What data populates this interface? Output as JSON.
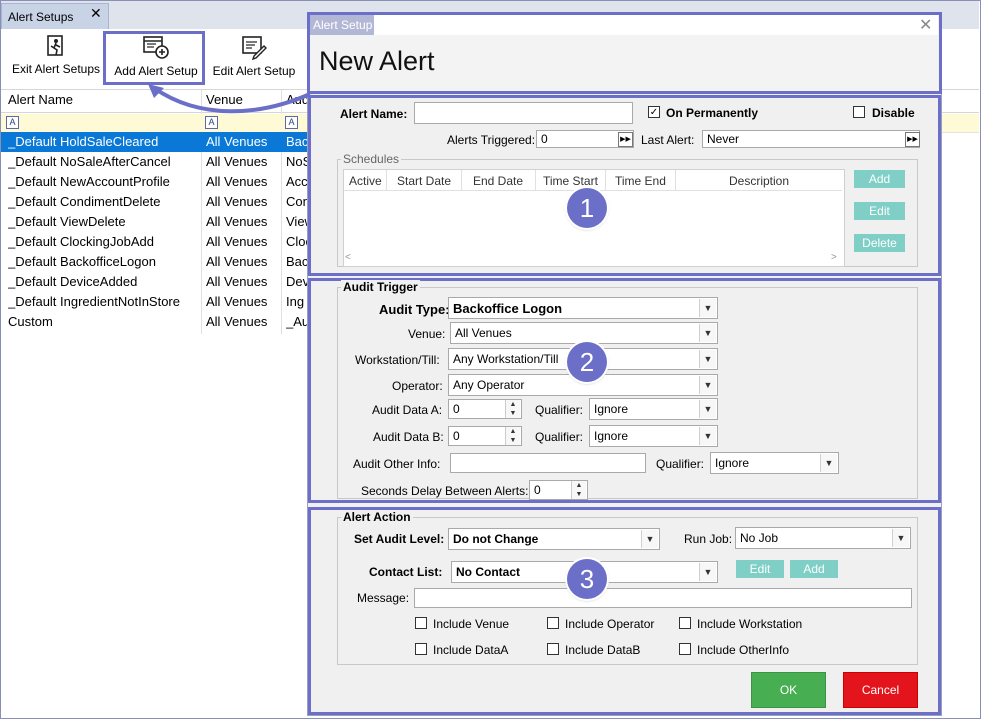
{
  "tab": {
    "title": "Alert Setups",
    "close": "✕"
  },
  "toolbar": {
    "exit_label": "Exit Alert Setups",
    "add_label": "Add Alert Setup",
    "edit_label": "Edit Alert Setup"
  },
  "grid": {
    "headers": [
      "Alert Name",
      "Venue",
      "Aud"
    ],
    "rows": [
      [
        "_Default HoldSaleCleared",
        "All Venues",
        "Bac"
      ],
      [
        "_Default NoSaleAfterCancel",
        "All Venues",
        "NoS"
      ],
      [
        "_Default NewAccountProfile",
        "All Venues",
        "Acc"
      ],
      [
        "_Default CondimentDelete",
        "All Venues",
        "Con"
      ],
      [
        "_Default ViewDelete",
        "All Venues",
        "View"
      ],
      [
        "_Default ClockingJobAdd",
        "All Venues",
        "Cloc"
      ],
      [
        "_Default BackofficeLogon",
        "All Venues",
        "Bac"
      ],
      [
        "_Default DeviceAdded",
        "All Venues",
        "Dev"
      ],
      [
        "_Default IngredientNotInStore",
        "All Venues",
        "Ing"
      ],
      [
        "Custom",
        "All Venues",
        "_Au"
      ]
    ],
    "selected_row": 0
  },
  "dialog": {
    "caption": "Alert Setup",
    "close": "✕",
    "title": "New Alert",
    "alert_name_label": "Alert Name:",
    "alert_name_value": "",
    "on_permanently_label": "On Permanently",
    "on_permanently_checked": true,
    "disable_label": "Disable",
    "disable_checked": false,
    "alerts_triggered_label": "Alerts Triggered:",
    "alerts_triggered_value": "0",
    "last_alert_label": "Last Alert:",
    "last_alert_value": "Never",
    "schedules": {
      "title": "Schedules",
      "columns": [
        "Active",
        "Start Date",
        "End Date",
        "Time Start",
        "Time End",
        "Description"
      ],
      "add": "Add",
      "edit": "Edit",
      "delete": "Delete"
    },
    "audit_trigger": {
      "title": "Audit Trigger",
      "audit_type_label": "Audit Type:",
      "audit_type_value": "Backoffice Logon",
      "venue_label": "Venue:",
      "venue_value": "All Venues",
      "workstation_label": "Workstation/Till:",
      "workstation_value": "Any Workstation/Till",
      "operator_label": "Operator:",
      "operator_value": "Any Operator",
      "data_a_label": "Audit Data A:",
      "data_a_value": "0",
      "data_b_label": "Audit Data B:",
      "data_b_value": "0",
      "qualifier_label": "Qualifier:",
      "qualifier_a_value": "Ignore",
      "qualifier_b_value": "Ignore",
      "other_info_label": "Audit Other Info:",
      "other_info_value": "",
      "qualifier_other_value": "Ignore",
      "delay_label": "Seconds Delay Between Alerts:",
      "delay_value": "0"
    },
    "alert_action": {
      "title": "Alert Action",
      "set_audit_level_label": "Set Audit Level:",
      "set_audit_level_value": "Do not Change",
      "run_job_label": "Run Job:",
      "run_job_value": "No Job",
      "contact_list_label": "Contact List:",
      "contact_list_value": "No Contact",
      "edit": "Edit",
      "add": "Add",
      "message_label": "Message:",
      "message_value": "",
      "include_venue": "Include Venue",
      "include_operator": "Include Operator",
      "include_workstation": "Include Workstation",
      "include_data_a": "Include DataA",
      "include_data_b": "Include DataB",
      "include_other_info": "Include OtherInfo"
    },
    "ok": "OK",
    "cancel": "Cancel"
  },
  "callouts": [
    "1",
    "2",
    "3"
  ],
  "colors": {
    "accent": "#6b6fc7",
    "selection": "#0a78d7",
    "ok": "#47ae52",
    "cancel": "#e4141c",
    "teal_button": "#7fcfc6"
  }
}
